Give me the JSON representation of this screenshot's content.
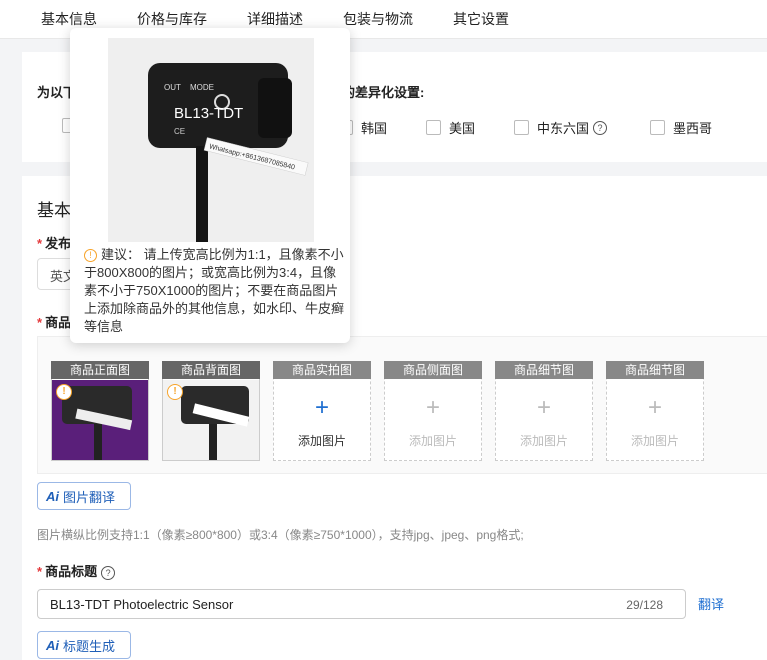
{
  "tabs": [
    "基本信息",
    "价格与库存",
    "详细描述",
    "包装与物流",
    "其它设置"
  ],
  "region": {
    "title_left": "为以下",
    "title_right": "的差异化设置:",
    "options": [
      {
        "label": "",
        "checked": false
      },
      {
        "label": "韩国",
        "checked": false
      },
      {
        "label": "美国",
        "checked": false
      },
      {
        "label": "中东六国",
        "checked": false
      },
      {
        "label": "墨西哥",
        "checked": false
      }
    ],
    "help_icon": "question-circle-icon"
  },
  "basic": {
    "section_title": "基本",
    "publish_label": "发布",
    "language_value": "英文",
    "images_label": "商品",
    "slots": [
      {
        "label": "商品正面图",
        "filled": true
      },
      {
        "label": "商品背面图",
        "filled": true
      },
      {
        "label": "商品实拍图",
        "filled": false,
        "add": "添加图片",
        "active": true
      },
      {
        "label": "商品侧面图",
        "filled": false,
        "add": "添加图片",
        "active": false
      },
      {
        "label": "商品细节图",
        "filled": false,
        "add": "添加图片",
        "active": false
      },
      {
        "label": "商品细节图",
        "filled": false,
        "add": "添加图片",
        "active": false
      }
    ],
    "img_translate_btn": "图片翻译",
    "ai_icon": "Ai",
    "hint": "图片横纵比例支持1:1（像素≥800*800）或3:4（像素≥750*1000），支持jpg、jpeg、png格式;",
    "title_label": "商品标题",
    "title_value": "BL13-TDT Photoelectric Sensor",
    "title_count": "29/128",
    "translate_link": "翻译",
    "title_gen_btn": "标题生成"
  },
  "popup": {
    "note": "建议： 请上传宽高比例为1:1，且像素不小于800X800的图片；或宽高比例为3:4，且像素不小于750X1000的图片；不要在商品图片上添加除商品外的其他信息，如水印、牛皮癣等信息",
    "product_text": "BL13-TDT",
    "watermark": "Whatsapp:+8613687085840",
    "out": "OUT",
    "mode": "MODE",
    "ce": "CE"
  },
  "colors": {
    "accent": "#1f6fd1",
    "warn": "#f7a42b",
    "required": "#e4393c"
  }
}
